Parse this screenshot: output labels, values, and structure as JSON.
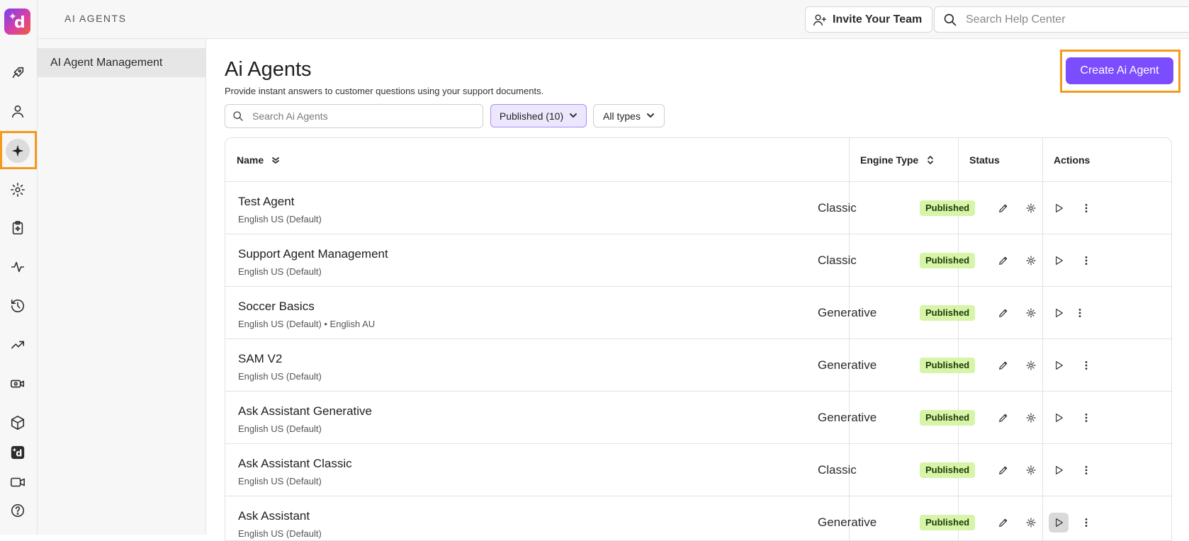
{
  "app": {
    "section_title": "AI AGENTS"
  },
  "rail": {
    "logo_letter": "d",
    "icons": [
      "rocket-icon",
      "user-icon",
      "sparkle-icon",
      "gear-icon",
      "clipboard-sparkle-icon",
      "activity-icon",
      "history-icon",
      "trending-up-icon",
      "video-settings-icon",
      "cube-icon",
      "brand-d-icon",
      "video-icon",
      "help-icon"
    ]
  },
  "subnav": {
    "items": [
      {
        "label": "AI Agent Management"
      }
    ]
  },
  "header": {
    "invite_label": "Invite Your Team",
    "help_search_placeholder": "Search Help Center"
  },
  "main": {
    "title": "Ai Agents",
    "subtitle": "Provide instant answers to customer questions using your support documents.",
    "create_label": "Create Ai Agent",
    "search_placeholder": "Search Ai Agents",
    "filter_status": "Published (10)",
    "filter_type": "All types"
  },
  "table": {
    "headers": {
      "name": "Name",
      "engine": "Engine Type",
      "status": "Status",
      "actions": "Actions"
    },
    "rows": [
      {
        "name": "Test Agent",
        "langs": "English US (Default)",
        "engine": "Classic",
        "status": "Published"
      },
      {
        "name": "Support Agent Management",
        "langs": "English US (Default)",
        "engine": "Classic",
        "status": "Published"
      },
      {
        "name": "Soccer Basics",
        "langs": "English US (Default) • English AU",
        "engine": "Generative",
        "status": "Published"
      },
      {
        "name": "SAM V2",
        "langs": "English US (Default)",
        "engine": "Generative",
        "status": "Published"
      },
      {
        "name": "Ask Assistant Generative",
        "langs": "English US (Default)",
        "engine": "Generative",
        "status": "Published"
      },
      {
        "name": "Ask Assistant Classic",
        "langs": "English US (Default)",
        "engine": "Classic",
        "status": "Published"
      },
      {
        "name": "Ask Assistant",
        "langs": "English US (Default)",
        "engine": "Generative",
        "status": "Published"
      }
    ]
  },
  "colors": {
    "accent": "#7c4dff",
    "highlight": "#f49a1c",
    "badge_bg": "#d6f5a8"
  }
}
